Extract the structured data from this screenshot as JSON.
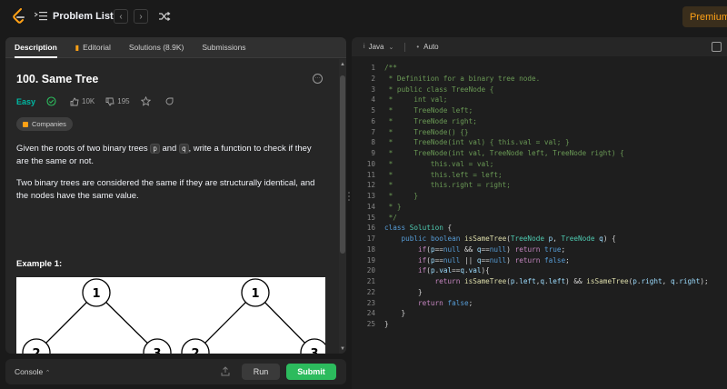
{
  "topbar": {
    "problem_list_label": "Problem List",
    "premium_label": "Premium",
    "prev_icon": "chevron-left-icon",
    "next_icon": "chevron-right-icon",
    "shuffle_icon": "shuffle-icon"
  },
  "tabs": [
    {
      "label": "Description",
      "icon": ""
    },
    {
      "label": "Editorial",
      "icon": "book-icon"
    },
    {
      "label": "Solutions (8.9K)",
      "icon": ""
    },
    {
      "label": "Submissions",
      "icon": ""
    }
  ],
  "problem": {
    "title": "100. Same Tree",
    "difficulty": "Easy",
    "likes": "10K",
    "dislikes": "195",
    "companies_label": "Companies",
    "para1_a": "Given the roots of two binary trees ",
    "para1_p": "p",
    "para1_b": " and ",
    "para1_q": "q",
    "para1_c": ", write a function to check if they are the same or not.",
    "para2": "Two binary trees are considered the same if they are structurally identical, and the nodes have the same value.",
    "example_label": "Example 1:",
    "tree_nodes": [
      "1",
      "2",
      "3",
      "1",
      "2",
      "3"
    ]
  },
  "bottombar": {
    "console_label": "Console",
    "run_label": "Run",
    "submit_label": "Submit"
  },
  "editor": {
    "language": "Java",
    "mode": "Auto",
    "line_numbers": [
      "1",
      "2",
      "3",
      "4",
      "5",
      "6",
      "7",
      "8",
      "9",
      "10",
      "11",
      "12",
      "13",
      "14",
      "15",
      "16",
      "17",
      "18",
      "19",
      "20",
      "21",
      "22",
      "23",
      "24",
      "25"
    ]
  },
  "colors": {
    "accent": "#ffa116",
    "easy": "#00b8a3",
    "submit": "#2cbb5d"
  }
}
